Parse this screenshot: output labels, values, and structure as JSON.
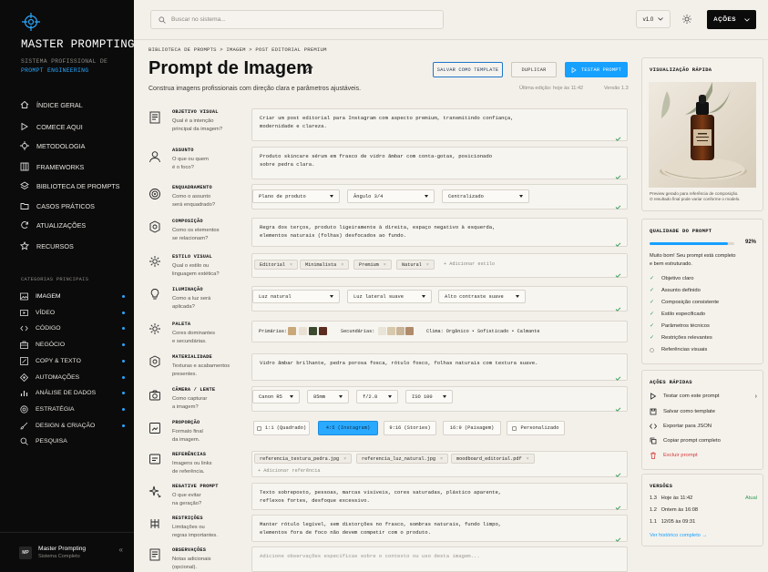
{
  "app": {
    "title": "MASTER PROMPTING",
    "subtitle_line1": "SISTEMA PROFISSIONAL DE",
    "subtitle_line2": "PROMPT ENGINEERING"
  },
  "nav": [
    {
      "label": "ÍNDICE GERAL",
      "icon": "home-icon"
    },
    {
      "label": "COMECE AQUI",
      "icon": "play-icon"
    },
    {
      "label": "METODOLOGIA",
      "icon": "crosshair-icon"
    },
    {
      "label": "FRAMEWORKS",
      "icon": "grid-icon"
    },
    {
      "label": "BIBLIOTECA DE PROMPTS",
      "icon": "layers-icon"
    },
    {
      "label": "CASOS PRÁTICOS",
      "icon": "folder-icon"
    },
    {
      "label": "ATUALIZAÇÕES",
      "icon": "refresh-icon"
    },
    {
      "label": "RECURSOS",
      "icon": "star-icon"
    }
  ],
  "categories_title": "CATEGORIAS PRINCIPAIS",
  "categories": [
    {
      "label": "IMAGEM",
      "icon": "image-icon",
      "dot": true
    },
    {
      "label": "VÍDEO",
      "icon": "video-icon",
      "dot": true
    },
    {
      "label": "CÓDIGO",
      "icon": "code-icon",
      "dot": true
    },
    {
      "label": "NEGÓCIO",
      "icon": "briefcase-icon",
      "dot": true
    },
    {
      "label": "COPY & TEXTO",
      "icon": "pen-icon",
      "dot": true
    },
    {
      "label": "AUTOMAÇÕES",
      "icon": "automation-icon",
      "dot": true
    },
    {
      "label": "ANÁLISE DE DADOS",
      "icon": "bar-chart-icon",
      "dot": true
    },
    {
      "label": "ESTRATÉGIA",
      "icon": "target-icon",
      "dot": true
    },
    {
      "label": "DESIGN & CRIAÇÃO",
      "icon": "brush-icon",
      "dot": true
    },
    {
      "label": "PESQUISA",
      "icon": "search-icon",
      "dot": false
    }
  ],
  "user": {
    "avatar": "MP",
    "name": "Master Prompting",
    "plan": "Sistema Completo",
    "collapse": "«"
  },
  "topbar": {
    "search_placeholder": "Buscar no sistema...",
    "version": "v1.0",
    "actions": "AÇÕES"
  },
  "breadcrumb": "BIBLIOTECA DE PROMPTS  >  IMAGEM  >  POST EDITORIAL PREMIUM",
  "page": {
    "title": "Prompt de Imagem",
    "description": "Construa imagens profissionais com direção clara e parâmetros ajustáveis.",
    "save_template": "SALVAR COMO TEMPLATE",
    "duplicate": "DUPLICAR",
    "test": "TESTAR PROMPT",
    "last_edit": "Última edição: hoje às 11:42",
    "version_meta": "Versão 1.3"
  },
  "fields": {
    "objetivo": {
      "title": "OBJETIVO VISUAL",
      "q1": "Qual é a intenção",
      "q2": "principal da imagem?",
      "l1": "Criar um post editorial para Instagram com aspecto premium, transmitindo confiança,",
      "l2": "modernidade e clareza."
    },
    "assunto": {
      "title": "ASSUNTO",
      "q1": "O que ou quem",
      "q2": "é o foco?",
      "l1": "Produto skincare sérum em frasco de vidro âmbar com conta-gotas, posicionado",
      "l2": "sobre pedra clara."
    },
    "enquadramento": {
      "title": "ENQUADRAMENTO",
      "q1": "Como o assunto",
      "q2": "será enquadrado?",
      "s1": "Plano de produto",
      "s2": "Ângulo 3/4",
      "s3": "Centralizado"
    },
    "composicao": {
      "title": "COMPOSIÇÃO",
      "q1": "Como os elementos",
      "q2": "se relacionam?",
      "l1": "Regra dos terços, produto ligeiramente à direita, espaço negativo à esquerda,",
      "l2": "elementos naturais (folhas) desfocados ao fundo."
    },
    "estilo": {
      "title": "ESTILO VISUAL",
      "q1": "Qual o estilo ou",
      "q2": "linguagem estética?",
      "tags": [
        "Editorial",
        "Minimalista",
        "Premium",
        "Natural"
      ],
      "add": "+ Adicionar estilo"
    },
    "iluminacao": {
      "title": "ILUMINAÇÃO",
      "q1": "Como a luz será",
      "q2": "aplicada?",
      "s1": "Luz natural",
      "s2": "Luz lateral suave",
      "s3": "Alto contraste suave"
    },
    "paleta": {
      "title": "PALETA",
      "q1": "Cores dominantes",
      "q2": "e secundárias.",
      "primarias": "Primárias:",
      "secundarias": "Secundárias:",
      "clima": "Clima: Orgânico • Sofisticado • Calmante",
      "primary_colors": [
        "#c9a87a",
        "#e9e2d4",
        "#3b4a2e",
        "#5a2d20"
      ],
      "secondary_colors": [
        "#eae4d8",
        "#d8c9ad",
        "#c8b497",
        "#b08b6b"
      ]
    },
    "materialidade": {
      "title": "MATERIALIDADE",
      "q1": "Texturas e acabamentos",
      "q2": "presentes.",
      "l1": "Vidro âmbar brilhante, pedra porosa fosca, rótulo fosco, folhas naturais com textura suave."
    },
    "camera": {
      "title": "CÂMERA / LENTE",
      "q1": "Como capturar",
      "q2": "a imagem?",
      "s1": "Canon R5",
      "s2": "85mm",
      "s3": "f/2.8",
      "s4": "ISO 100"
    },
    "proporcao": {
      "title": "PROPORÇÃO",
      "q1": "Formato final",
      "q2": "da imagem.",
      "opts": [
        "1:1 (Quadrado)",
        "4:5 (Instagram)",
        "9:16 (Stories)",
        "16:9 (Paisagem)",
        "Personalizado"
      ]
    },
    "referencias": {
      "title": "REFERÊNCIAS",
      "q1": "Imagens ou links",
      "q2": "de referência.",
      "files": [
        "referencia_textura_pedra.jpg",
        "referencia_luz_natural.jpg",
        "moodboard_editorial.pdf"
      ],
      "add": "+ Adicionar referência"
    },
    "negativo": {
      "title": "NEGATIVE PROMPT",
      "q1": "O que evitar",
      "q2": "na geração?",
      "l1": "Texto sobreposto, pessoas, marcas visíveis, cores saturadas, plástico aparente,",
      "l2": "reflexos fortes, desfoque excessivo."
    },
    "restricoes": {
      "title": "RESTRIÇÕES",
      "q1": "Limitações ou",
      "q2": "regras importantes.",
      "l1": "Manter rótulo legível, sem distorções no frasco, sombras naturais, fundo limpo,",
      "l2": "elementos fora de foco não devem competir com o produto."
    },
    "observacoes": {
      "title": "OBSERVAÇÕES",
      "q1": "Notas adicionais",
      "q2": "(opcional).",
      "placeholder": "Adicione observações específicas sobre o contexto ou uso desta imagem..."
    }
  },
  "preview": {
    "title": "VISUALIZAÇÃO RÁPIDA",
    "caption1": "Preview gerado para referência de composição.",
    "caption2": "O resultado final pode variar conforme o modelo."
  },
  "quality": {
    "title": "QUALIDADE DO PROMPT",
    "percent_label": "92%",
    "percent": 0.92,
    "desc1": "Muito bom! Seu prompt está completo",
    "desc2": "e bem estruturado.",
    "items": [
      {
        "label": "Objetivo claro",
        "ok": true
      },
      {
        "label": "Assunto definido",
        "ok": true
      },
      {
        "label": "Composição consistente",
        "ok": true
      },
      {
        "label": "Estilo especificado",
        "ok": true
      },
      {
        "label": "Parâmetros técnicos",
        "ok": true
      },
      {
        "label": "Restrições relevantes",
        "ok": true
      },
      {
        "label": "Referências visuais",
        "ok": false
      }
    ]
  },
  "quick": {
    "title": "AÇÕES RÁPIDAS",
    "items": [
      {
        "label": "Testar com este prompt",
        "icon": "play-icon"
      },
      {
        "label": "Salvar como template",
        "icon": "save-icon"
      },
      {
        "label": "Exportar para JSON",
        "icon": "code-icon"
      },
      {
        "label": "Copiar prompt completo",
        "icon": "copy-icon"
      },
      {
        "label": "Excluir prompt",
        "icon": "trash-icon"
      }
    ]
  },
  "versions": {
    "title": "VERSÕES",
    "items": [
      {
        "v": "1.3",
        "when": "Hoje às 11:42",
        "current": "Atual"
      },
      {
        "v": "1.2",
        "when": "Ontem às 16:08",
        "current": ""
      },
      {
        "v": "1.1",
        "when": "12/05 às 09:31",
        "current": ""
      }
    ],
    "link": "Ver histórico completo  →"
  },
  "colors": {
    "accent": "#16a0ff",
    "success": "#2f9b55",
    "danger": "#d43b3b",
    "sidebar_bg": "#0b0b0b"
  }
}
